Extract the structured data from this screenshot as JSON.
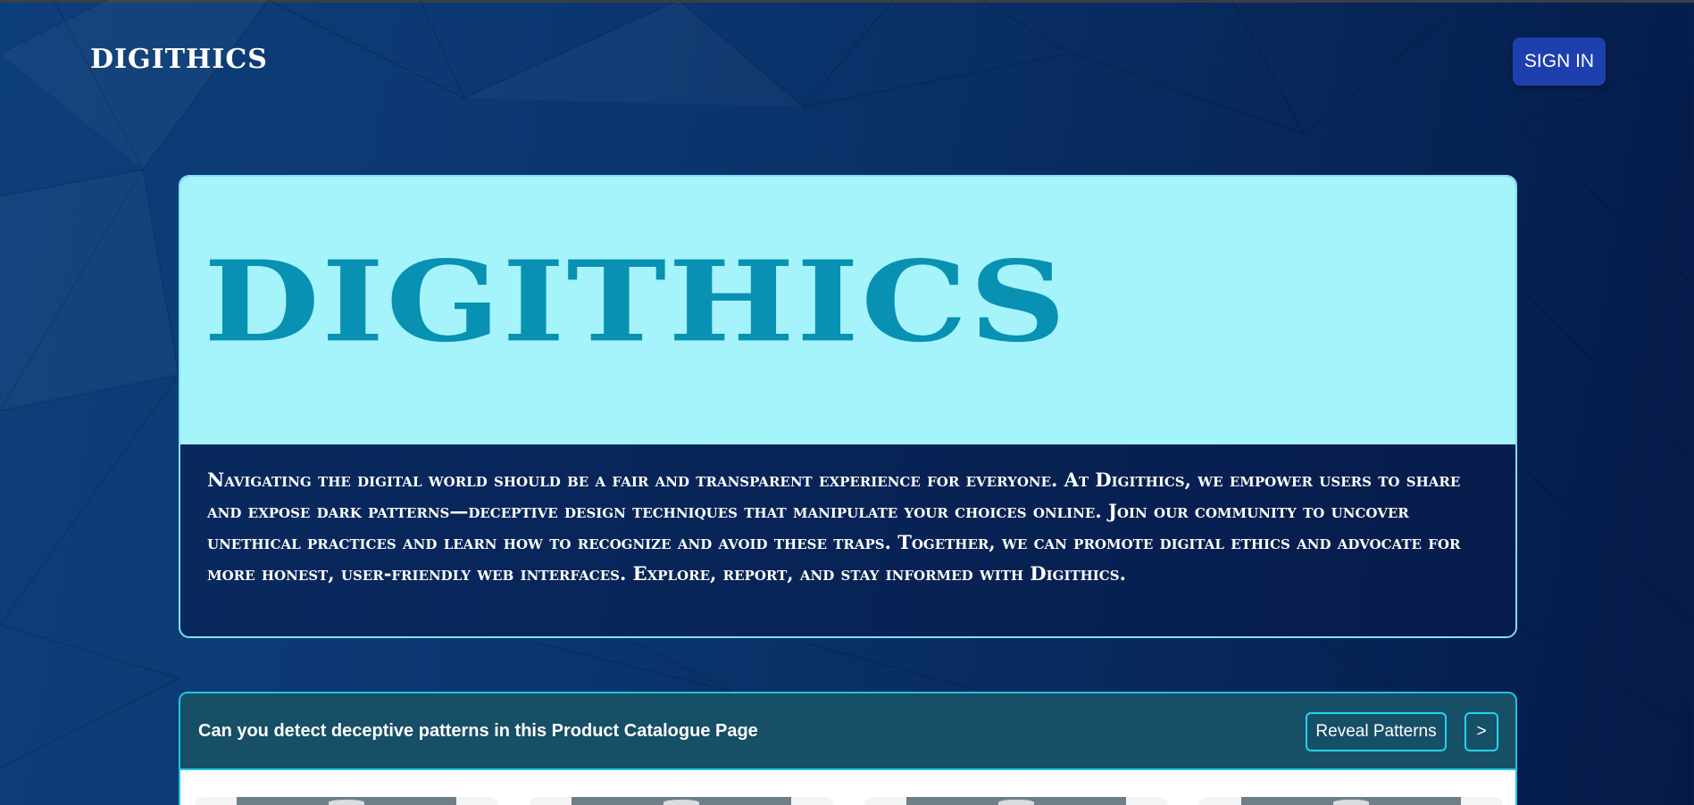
{
  "header": {
    "brand": "DIGITHICS",
    "signin_label": "SIGN IN"
  },
  "hero": {
    "title": "DIGITHICS",
    "description": "Navigating the digital world should be a fair and transparent experience for everyone. At Digithics, we empower users to share and expose dark patterns—deceptive design techniques that manipulate your choices online. Join our community to uncover unethical practices and learn how to recognize and avoid these traps. Together, we can promote digital ethics and advocate for more honest, user-friendly web interfaces. Explore, report, and stay informed with Digithics."
  },
  "demo": {
    "question": "Can you detect deceptive patterns in this Product Catalogue Page",
    "reveal_label": "Reveal Patterns",
    "next_label": ">"
  },
  "catalog": {
    "products": [
      {},
      {},
      {},
      {}
    ]
  },
  "colors": {
    "accent_cyan": "#0891b2",
    "hero_light": "#a5f3fb",
    "button_blue": "#1e3fae",
    "demo_bar": "#164f66",
    "border_cyan": "#22d3ee"
  }
}
